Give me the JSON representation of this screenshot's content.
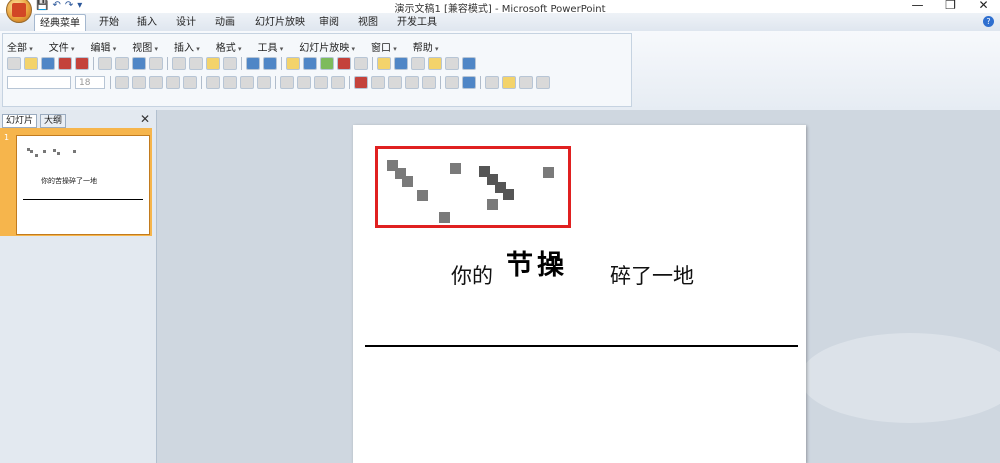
{
  "window": {
    "title": "演示文稿1 [兼容模式] - Microsoft PowerPoint",
    "controls": [
      "—",
      "❐",
      "✕"
    ]
  },
  "qat": {
    "items": [
      "save-icon",
      "undo-icon",
      "redo-icon",
      "customize-icon"
    ]
  },
  "tabs": [
    {
      "label": "经典菜单",
      "active": true
    },
    {
      "label": "开始"
    },
    {
      "label": "插入"
    },
    {
      "label": "设计"
    },
    {
      "label": "动画"
    },
    {
      "label": "幻灯片放映"
    },
    {
      "label": "审阅"
    },
    {
      "label": "视图"
    },
    {
      "label": "开发工具"
    }
  ],
  "menu": [
    "全部",
    "文件",
    "编辑",
    "视图",
    "插入",
    "格式",
    "工具",
    "幻灯片放映",
    "窗口",
    "帮助"
  ],
  "font_size_value": "18",
  "left_pane": {
    "tab_slides": "幻灯片",
    "tab_outline": "大纲",
    "slide_number": "1",
    "thumb_text": "你的苦操碎了一地"
  },
  "slide": {
    "text_before": "你的",
    "text_brush": "节操",
    "text_after": "碎了一地"
  },
  "colors": {
    "highlight": "#e02020",
    "accent": "#f6b54c"
  }
}
